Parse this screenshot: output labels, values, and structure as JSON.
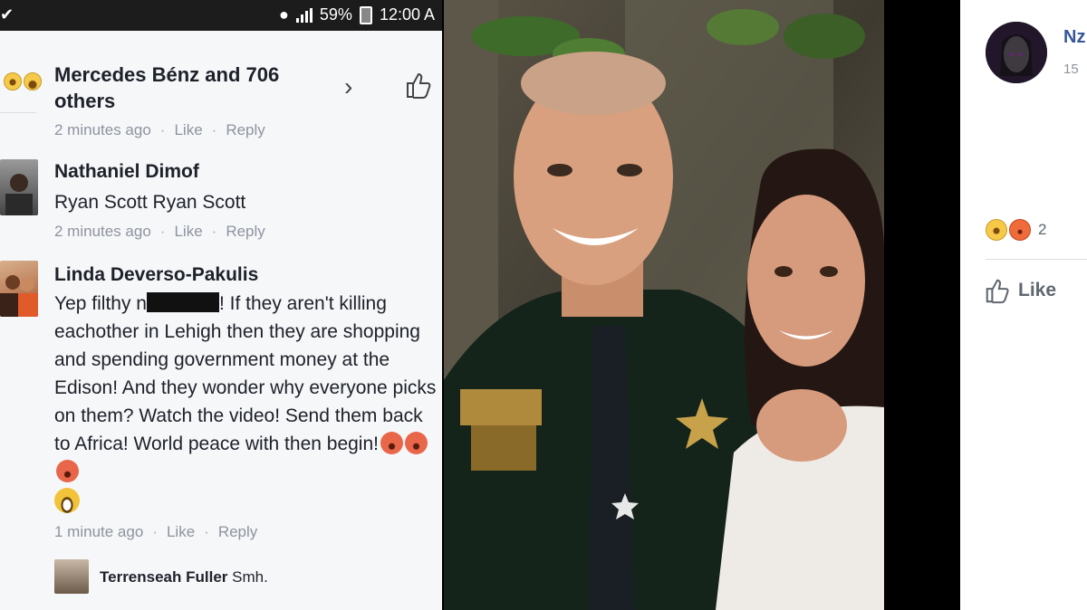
{
  "status_bar": {
    "battery": "59%",
    "time": "12:00 A"
  },
  "likes": {
    "text": "Mercedes Bénz and 706 others",
    "reactions": [
      "wow-icon",
      "haha-icon"
    ]
  },
  "first_meta": {
    "time": "2 minutes ago",
    "like": "Like",
    "reply": "Reply"
  },
  "comments": [
    {
      "name": "Nathaniel Dimof",
      "text": "Ryan Scott Ryan Scott",
      "time": "2 minutes ago",
      "like": "Like",
      "reply": "Reply"
    },
    {
      "name": "Linda Deverso-Pakulis",
      "text_before": "Yep filthy n",
      "text_after": "! If they aren't killing eachother in Lehigh then they are shopping and spending government money at the Edison! And they wonder why everyone picks on them? Watch the video! Send them back to Africa! World peace with then begin!",
      "time": "1 minute ago",
      "like": "Like",
      "reply": "Reply"
    },
    {
      "name": "Terrenseah Fuller",
      "text": "Smh."
    }
  ],
  "fb_post": {
    "name": "Nz",
    "time": "15",
    "reaction_count": "2",
    "like_label": "Like"
  },
  "colors": {
    "fb_blue": "#365899",
    "text_dark": "#1d2129",
    "meta_gray": "#8d949e"
  }
}
